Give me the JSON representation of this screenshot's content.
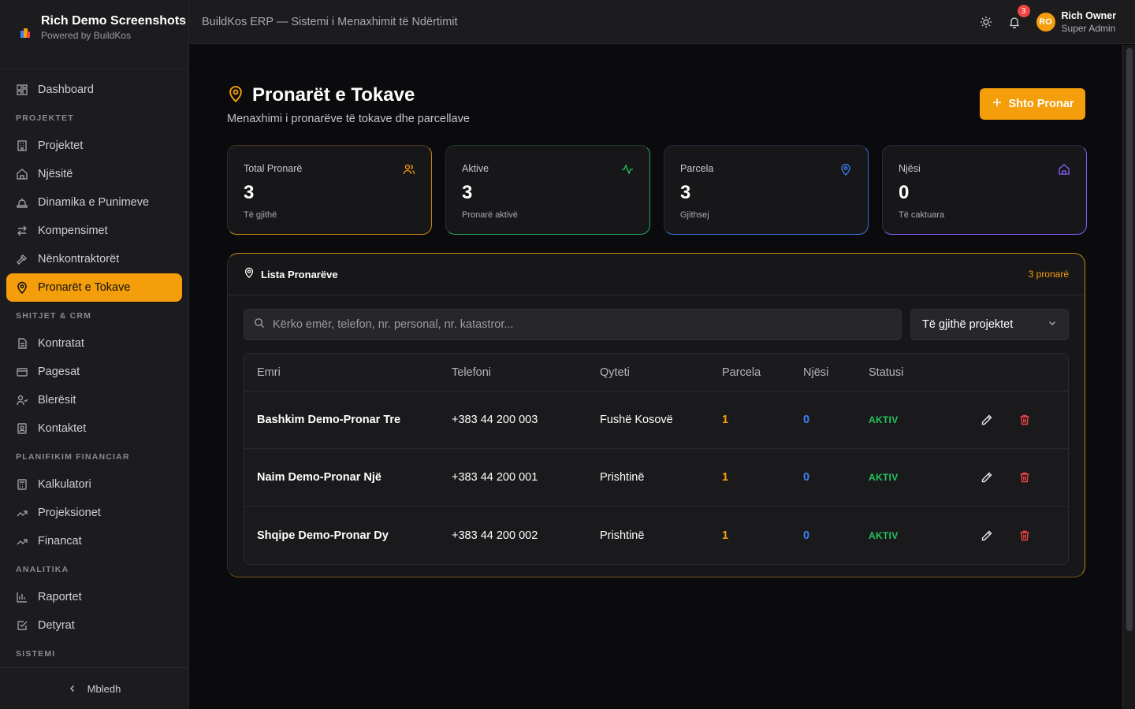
{
  "brand": {
    "name": "Rich Demo Screenshots",
    "powered": "Powered by BuildKos"
  },
  "sidebar": {
    "dashboard": "Dashboard",
    "sections": [
      {
        "title": "PROJEKTET",
        "items": [
          {
            "label": "Projektet",
            "icon": "building-icon"
          },
          {
            "label": "Njësitë",
            "icon": "home-icon"
          },
          {
            "label": "Dinamika e Punimeve",
            "icon": "construction-icon"
          },
          {
            "label": "Kompensimet",
            "icon": "arrows-icon"
          },
          {
            "label": "Nënkontraktorët",
            "icon": "hammer-icon"
          },
          {
            "label": "Pronarët e Tokave",
            "icon": "map-pin-icon",
            "active": true
          }
        ]
      },
      {
        "title": "SHITJET & CRM",
        "items": [
          {
            "label": "Kontratat",
            "icon": "file-icon"
          },
          {
            "label": "Pagesat",
            "icon": "card-icon"
          },
          {
            "label": "Blerësit",
            "icon": "user-check-icon"
          },
          {
            "label": "Kontaktet",
            "icon": "contact-icon"
          }
        ]
      },
      {
        "title": "PLANIFIKIM FINANCIAR",
        "items": [
          {
            "label": "Kalkulatori",
            "icon": "calculator-icon"
          },
          {
            "label": "Projeksionet",
            "icon": "trend-icon"
          },
          {
            "label": "Financat",
            "icon": "trend-icon"
          }
        ]
      },
      {
        "title": "ANALITIKA",
        "items": [
          {
            "label": "Raportet",
            "icon": "bar-chart-icon"
          },
          {
            "label": "Detyrat",
            "icon": "check-square-icon"
          }
        ]
      },
      {
        "title": "SISTEMI",
        "items": []
      }
    ],
    "collapse": "Mbledh"
  },
  "header": {
    "title": "BuildKos ERP — Sistemi i Menaxhimit të Ndërtimit",
    "notifications": "3",
    "avatar": "RO",
    "user_name": "Rich Owner",
    "user_role": "Super Admin"
  },
  "page": {
    "title": "Pronarët e Tokave",
    "subtitle": "Menaxhimi i pronarëve të tokave dhe parcellave",
    "add_button": "Shto Pronar"
  },
  "stats": [
    {
      "label": "Total Pronarë",
      "value": "3",
      "sub": "Të gjithë",
      "color": "#f59e0b"
    },
    {
      "label": "Aktive",
      "value": "3",
      "sub": "Pronarë aktivë",
      "color": "#22c55e"
    },
    {
      "label": "Parcela",
      "value": "3",
      "sub": "Gjithsej",
      "color": "#3b82f6"
    },
    {
      "label": "Njësi",
      "value": "0",
      "sub": "Të caktuara",
      "color": "#8b5cf6"
    }
  ],
  "list": {
    "title": "Lista Pronarëve",
    "count": "3 pronarë",
    "search_placeholder": "Kërko emër, telefon, nr. personal, nr. katastror...",
    "project_filter": "Të gjithë projektet",
    "columns": [
      "Emri",
      "Telefoni",
      "Qyteti",
      "Parcela",
      "Njësi",
      "Statusi"
    ],
    "rows": [
      {
        "name": "Bashkim Demo-Pronar Tre",
        "phone": "+383 44 200 003",
        "city": "Fushë Kosovë",
        "parcels": "1",
        "units": "0",
        "status": "AKTIV"
      },
      {
        "name": "Naim Demo-Pronar Një",
        "phone": "+383 44 200 001",
        "city": "Prishtinë",
        "parcels": "1",
        "units": "0",
        "status": "AKTIV"
      },
      {
        "name": "Shqipe Demo-Pronar Dy",
        "phone": "+383 44 200 002",
        "city": "Prishtinë",
        "parcels": "1",
        "units": "0",
        "status": "AKTIV"
      }
    ]
  }
}
